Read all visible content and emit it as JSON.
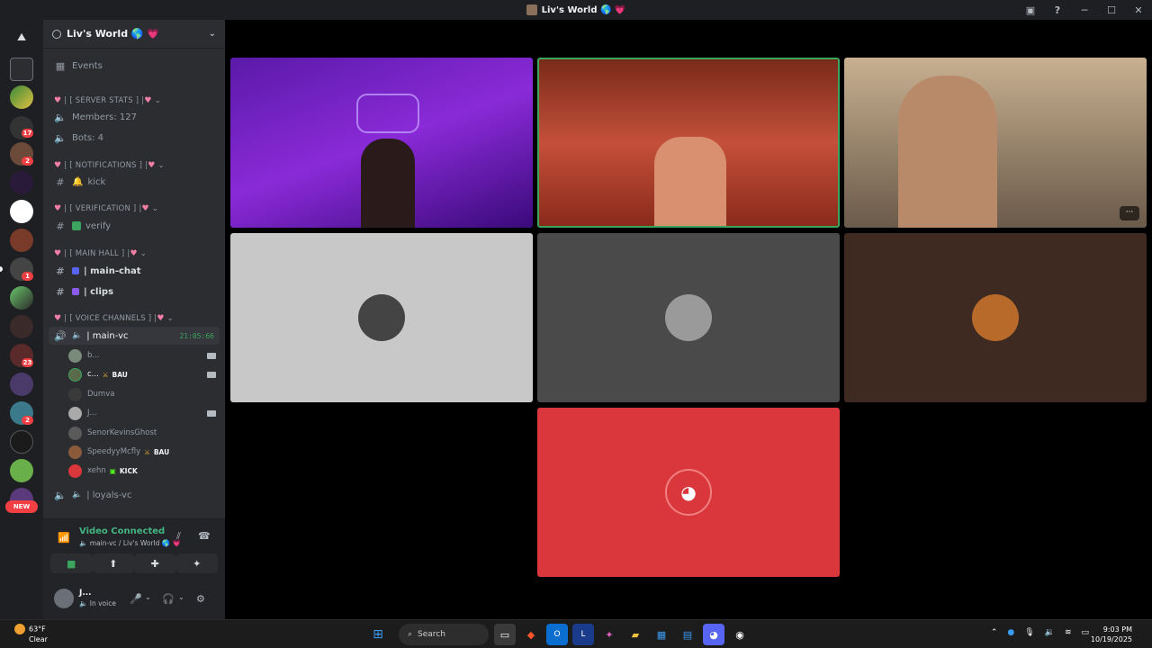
{
  "window": {
    "title": "Liv's World 🌎 💗",
    "help_icon": "?",
    "inbox_icon": "inbox-icon"
  },
  "rail": {
    "badges": [
      "17",
      "2",
      "1",
      "23",
      "2"
    ],
    "new_label": "NEW"
  },
  "server": {
    "name": "Liv's World 🌎 💗",
    "events_label": "Events"
  },
  "channels": {
    "server_stats_cat": "[ SERVER STATS ]",
    "members": "Members: 127",
    "bots": "Bots: 4",
    "notifications_cat": "[ NOTIFICATIONS ]",
    "kick": "kick",
    "verification_cat": "[ VERIFICATION ]",
    "verify": "verify",
    "main_hall_cat": "[ MAIN HALL ]",
    "main_chat": "| main-chat",
    "clips": "| clips",
    "voice_cat": "[ VOICE CHANNELS ]",
    "main_vc": "| main-vc",
    "main_vc_timer": "21:05:66",
    "loyals_vc": "| loyals-vc"
  },
  "voice_users": [
    {
      "name": "b...",
      "tag": "",
      "cam": true
    },
    {
      "name": "c...",
      "tag": "BAU",
      "cam": true
    },
    {
      "name": "Dumva",
      "tag": "",
      "cam": false
    },
    {
      "name": "J...",
      "tag": "",
      "cam": true
    },
    {
      "name": "SenorKevinsGhost",
      "tag": "",
      "cam": false
    },
    {
      "name": "SpeedyyMcfly",
      "tag": "BAU",
      "cam": false
    },
    {
      "name": "xehn",
      "tag": "KICK",
      "cam": false
    }
  ],
  "voice_panel": {
    "status": "Video Connected",
    "location": "main-vc / Liv's World 🌎 💗"
  },
  "user": {
    "name": "J...",
    "status": "In voice"
  },
  "taskbar": {
    "temp": "63°F",
    "weather": "Clear",
    "search": "Search",
    "time": "9:03 PM",
    "date": "10/19/2025"
  },
  "colors": {
    "bg": "#000000",
    "sidebar": "#2b2d31",
    "rail": "#1e1f22",
    "accent_green": "#3ba55d",
    "discord_red": "#da373c"
  }
}
